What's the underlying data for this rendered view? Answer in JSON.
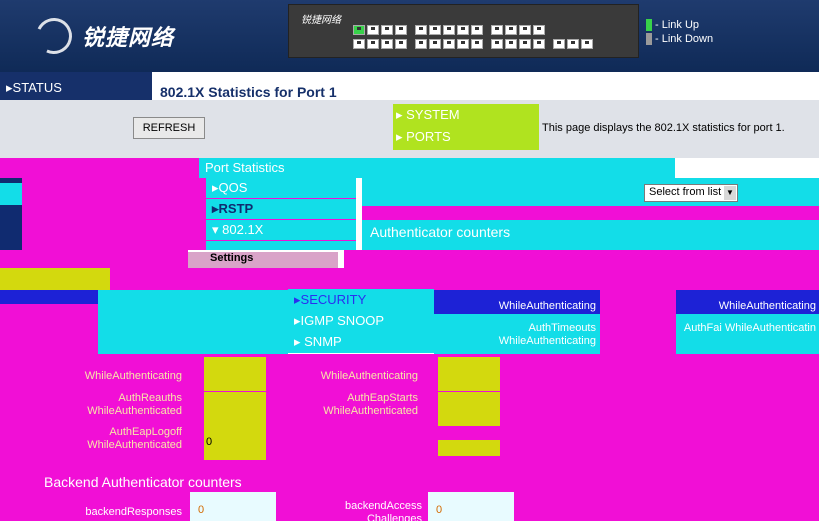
{
  "brand": {
    "logo_text": "锐捷网络",
    "switch_logo_text": "锐捷网络"
  },
  "legend": {
    "link_up": "- Link Up",
    "link_down": "- Link Down",
    "up_color": "#38d24a",
    "down_color": "#9a9a9a"
  },
  "nav": {
    "status": "STATUS",
    "menu": [
      "SYSTEM",
      "PORTS"
    ],
    "submenu": [
      "QOS",
      "RSTP",
      "802.1X"
    ],
    "section_nav": [
      "SECURITY",
      "IGMP SNOOP",
      "SNMP"
    ],
    "settings": "Settings"
  },
  "page": {
    "title": "802.1X Statistics for Port 1",
    "refresh_label": "REFRESH",
    "info_text": "This page displays the 802.1X statistics for port 1.",
    "port_statistics": "Port Statistics",
    "select_value": "Select from list",
    "authenticator_counters": "Authenticator counters",
    "backend_counters": "Backend Authenticator counters"
  },
  "counters_left": [
    {
      "label": "WhileAuthenticating",
      "value": ""
    },
    {
      "label": "AuthReauths WhileAuthenticated",
      "value": ""
    },
    {
      "label": "AuthEapLogoff WhileAuthenticated",
      "value": "0"
    }
  ],
  "counters_mid": [
    {
      "label": "AuthTimeouts WhileAuthenticating",
      "value": ""
    },
    {
      "label": "WhileAuthenticating",
      "value": ""
    },
    {
      "label": "AuthEapStarts WhileAuthenticated",
      "value": ""
    }
  ],
  "counters_right": [
    {
      "label": "WhileAuthenticating"
    },
    {
      "label": "AuthFai WhileAuthenticatin"
    }
  ],
  "backend": [
    {
      "label": "backendResponses",
      "value": "0"
    },
    {
      "label": "backendAccess Challenges",
      "value": "0"
    }
  ],
  "colors": {
    "banner": "#0f2a57",
    "teal": "#13dde8",
    "magenta": "#f10fd6",
    "lime": "#b0e31f",
    "yellow": "#d3d90e"
  }
}
